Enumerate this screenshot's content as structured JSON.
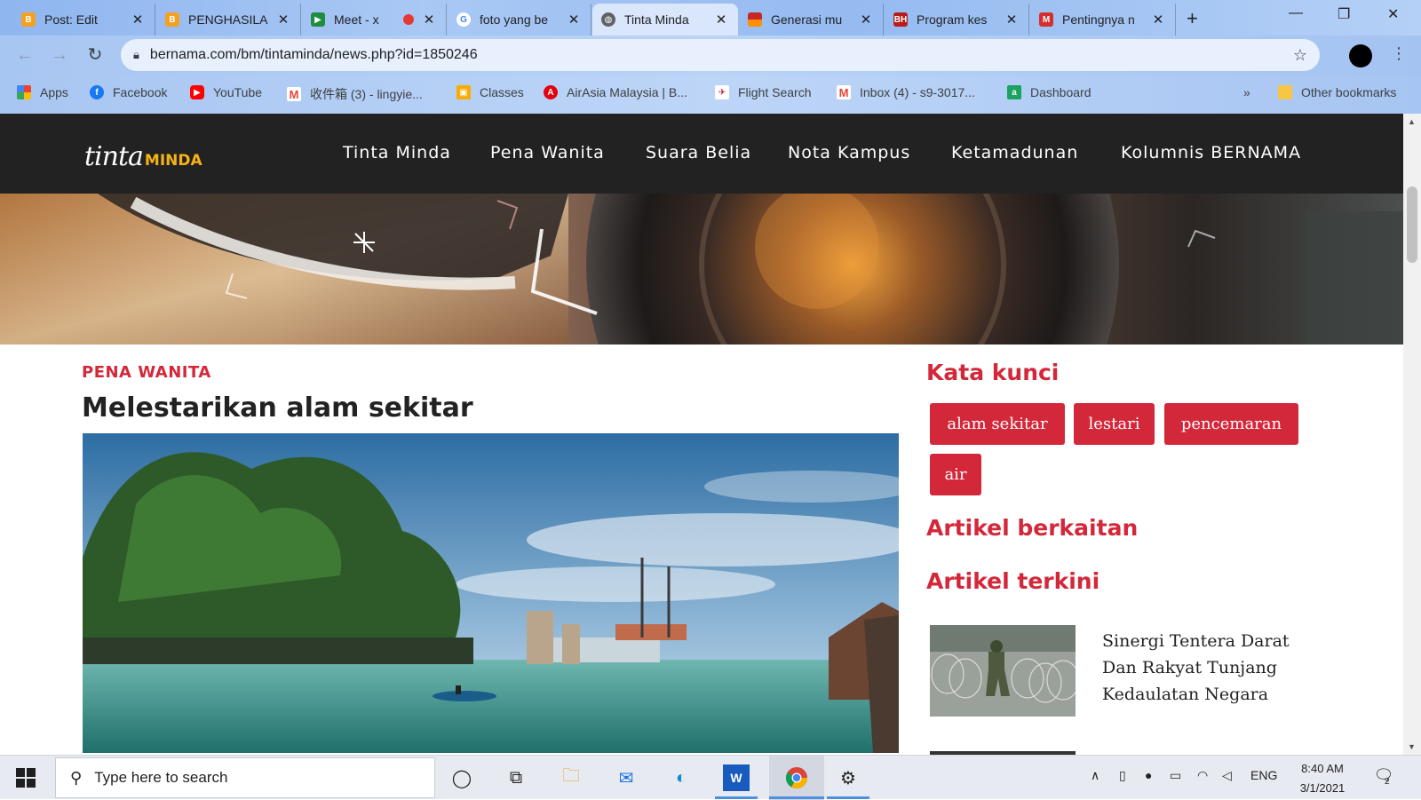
{
  "browser": {
    "tabs": [
      {
        "title": "Post: Edit",
        "color": "#f4a021"
      },
      {
        "title": "PENGHASILA",
        "color": "#f4a021"
      },
      {
        "title": "Meet - x",
        "color": "#1e8e3e"
      },
      {
        "title": "foto yang be",
        "color": "#4285f4"
      },
      {
        "title": "Tinta Minda",
        "color": "#5f6368"
      },
      {
        "title": "Generasi mu",
        "color": "#c62828"
      },
      {
        "title": "Program kes",
        "color": "#b71c1c"
      },
      {
        "title": "Pentingnya n",
        "color": "#d32f2f"
      }
    ],
    "url": "bernama.com/bm/tintaminda/news.php?id=1850246",
    "bookmarks": [
      {
        "label": "Apps",
        "icon": "apps-grid-icon"
      },
      {
        "label": "Facebook",
        "icon": "facebook-icon"
      },
      {
        "label": "YouTube",
        "icon": "youtube-icon"
      },
      {
        "label": "收件箱 (3) - lingyie...",
        "icon": "gmail-icon"
      },
      {
        "label": "Classes",
        "icon": "classroom-icon"
      },
      {
        "label": "AirAsia Malaysia | B...",
        "icon": "airasia-icon"
      },
      {
        "label": "Flight Search",
        "icon": "flight-icon"
      },
      {
        "label": "Inbox (4) - s9-3017...",
        "icon": "gmail-icon"
      },
      {
        "label": "Dashboard",
        "icon": "dashboard-icon"
      }
    ],
    "more_bookmarks": "»",
    "other_bookmarks": "Other bookmarks"
  },
  "site": {
    "logo_script": "tinta",
    "logo_brand": "MINDA",
    "nav": [
      "Tinta Minda",
      "Pena Wanita",
      "Suara Belia",
      "Nota Kampus",
      "Ketamadunan",
      "Kolumnis BERNAMA"
    ]
  },
  "article": {
    "category": "PENA WANITA",
    "title": "Melestarikan alam sekitar"
  },
  "sidebar": {
    "keywords_heading": "Kata kunci",
    "tags": [
      "alam sekitar",
      "lestari",
      "pencemaran",
      "air"
    ],
    "related_heading": "Artikel berkaitan",
    "latest_heading": "Artikel terkini",
    "latest": [
      {
        "title": "Sinergi Tentera Darat Dan Rakyat Tunjang Kedaulatan Negara"
      }
    ]
  },
  "taskbar": {
    "search_placeholder": "Type here to search",
    "language": "ENG",
    "time": "8:40 AM",
    "date": "3/1/2021",
    "notifications": "2"
  },
  "colors": {
    "accent_red": "#d3283a",
    "header_dark": "#222222",
    "logo_gold": "#f5b318"
  }
}
